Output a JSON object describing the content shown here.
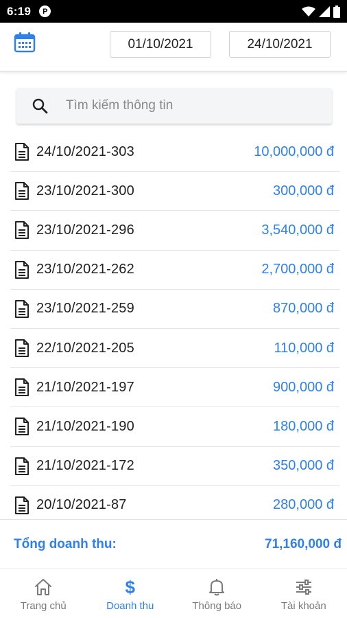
{
  "status_bar": {
    "time": "6:19",
    "app_icon_letter": "P"
  },
  "filter": {
    "date_from": "01/10/2021",
    "date_to": "24/10/2021"
  },
  "search": {
    "placeholder": "Tìm kiếm thông tin"
  },
  "colors": {
    "accent": "#2f80ed",
    "inactive": "#7a7a7a"
  },
  "items": [
    {
      "code": "24/10/2021-303",
      "amount": "10,000,000 đ"
    },
    {
      "code": "23/10/2021-300",
      "amount": "300,000 đ"
    },
    {
      "code": "23/10/2021-296",
      "amount": "3,540,000 đ"
    },
    {
      "code": "23/10/2021-262",
      "amount": "2,700,000 đ"
    },
    {
      "code": "23/10/2021-259",
      "amount": "870,000 đ"
    },
    {
      "code": "22/10/2021-205",
      "amount": "110,000 đ"
    },
    {
      "code": "21/10/2021-197",
      "amount": "900,000 đ"
    },
    {
      "code": "21/10/2021-190",
      "amount": "180,000 đ"
    },
    {
      "code": "21/10/2021-172",
      "amount": "350,000 đ"
    },
    {
      "code": "20/10/2021-87",
      "amount": "280,000 đ"
    }
  ],
  "total": {
    "label": "Tổng doanh thu:",
    "value": "71,160,000 đ"
  },
  "nav": [
    {
      "label": "Trang chủ",
      "icon": "home-icon",
      "active": false
    },
    {
      "label": "Doanh thu",
      "icon": "dollar-icon",
      "active": true
    },
    {
      "label": "Thông báo",
      "icon": "bell-icon",
      "active": false
    },
    {
      "label": "Tài khoản",
      "icon": "sliders-icon",
      "active": false
    }
  ]
}
